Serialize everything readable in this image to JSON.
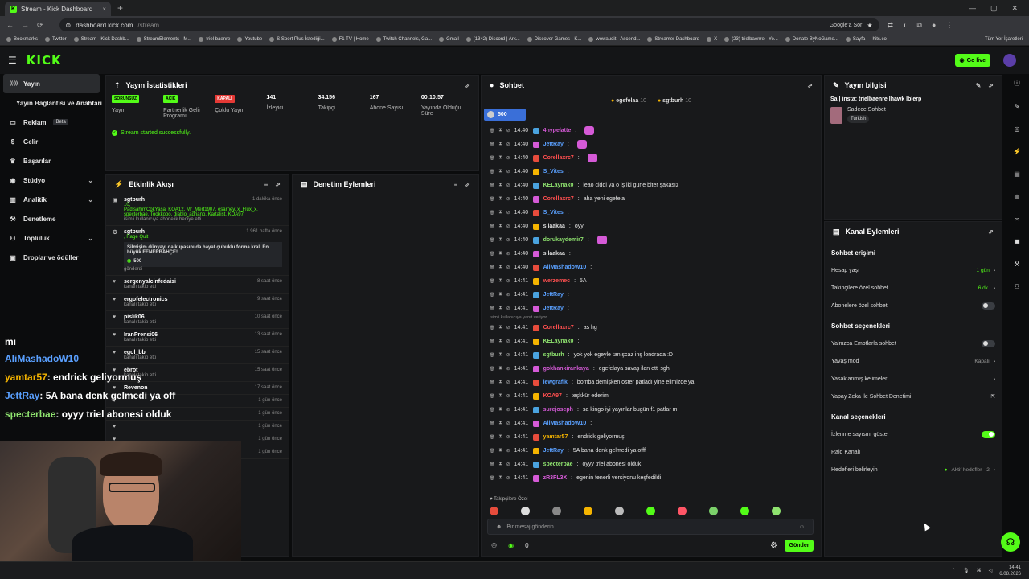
{
  "browser": {
    "tab_title": "Stream - Kick Dashboard",
    "url_host": "dashboard.kick.com",
    "url_path": "/stream",
    "google_sor": "Google'a Sor",
    "bookmarks": [
      "Bookmarks",
      "Twitter",
      "Stream - Kick Dashb...",
      "StreamElements - M...",
      "triel baenre",
      "Youtube",
      "S Sport Plus-İstediği...",
      "F1 TV | Home",
      "Twitch Channels, Ga...",
      "Gmail",
      "(1342) Discord | Ark...",
      "Discover Games - K...",
      "wowaudit - Ascend...",
      "Streamer Dashboard",
      "X",
      "(23) trielbaenre - Yo...",
      "Donate ByNoGame...",
      "Sayfa — hits.co"
    ],
    "bookmarks_right": "Tüm Yer İşaretleri"
  },
  "topbar": {
    "logo": "KICK",
    "go_live": "Go live"
  },
  "sidebar": {
    "items": [
      {
        "label": "Yayın",
        "icon": "broadcast-icon"
      },
      {
        "label": "Yayın Bağlantısı ve Anahtarı",
        "icon": ""
      },
      {
        "label": "Reklam",
        "icon": "ad-icon",
        "badge": "Beta"
      },
      {
        "label": "Gelir",
        "icon": "money-icon"
      },
      {
        "label": "Başarılar",
        "icon": "trophy-icon"
      },
      {
        "label": "Stüdyo",
        "icon": "studio-icon"
      },
      {
        "label": "Analitik",
        "icon": "chart-icon"
      },
      {
        "label": "Denetleme",
        "icon": "hammer-icon"
      },
      {
        "label": "Topluluk",
        "icon": "community-icon"
      },
      {
        "label": "Droplar ve ödüller",
        "icon": "gift-icon"
      }
    ]
  },
  "stats": {
    "title": "Yayın İstatistikleri",
    "items": [
      {
        "badge": "SORUNSUZ",
        "badge_color": "#53fc18",
        "label": "Yayın"
      },
      {
        "badge": "AÇIK",
        "badge_color": "#53fc18",
        "label": "Partnerlik Gelir Programı"
      },
      {
        "badge": "KAPALI",
        "badge_color": "#e53935",
        "label": "Çoklu Yayın"
      },
      {
        "value": "141",
        "label": "İzleyici"
      },
      {
        "value": "34.156",
        "label": "Takipçi"
      },
      {
        "value": "167",
        "label": "Abone Sayısı"
      },
      {
        "value": "00:10:57",
        "label": "Yayında Olduğu Süre"
      }
    ],
    "success": "Stream started successfully."
  },
  "activity": {
    "title": "Etkinlik Akışı",
    "events": [
      {
        "name": "sgtburh",
        "time": "1 dakika önce",
        "count": "10,",
        "list": "PadisahimCokYasa, KOA12, Mr_Mert1907, esarney, x_Flux_x, specterbae, Tookkooo, diablo_adriano, Kartalist, KOA97",
        "sub": "isimli kullanıcıya abonelik hediye etti."
      },
      {
        "name": "sgtburh",
        "time": "1.961 hafta önce",
        "tag": ", Rage Quit",
        "quote": "Silmişim dünyayı da kupasını da hayat çubuklu forma kral. En büyük FENERBAHÇE!",
        "amount": "500",
        "sub": "gönderdi"
      },
      {
        "name": "sergenyalcinfedaisi",
        "time": "8 saat önce",
        "sub": "kanalı takip etti"
      },
      {
        "name": "ergofelectronics",
        "time": "9 saat önce",
        "sub": "kanalı takip etti"
      },
      {
        "name": "pislik06",
        "time": "10 saat önce",
        "sub": "kanalı takip etti"
      },
      {
        "name": "IranPrensi06",
        "time": "13 saat önce",
        "sub": "kanalı takip etti"
      },
      {
        "name": "egol_bb",
        "time": "15 saat önce",
        "sub": "kanalı takip etti"
      },
      {
        "name": "ebrot",
        "time": "15 saat önce",
        "sub": "kanalı takip etti"
      },
      {
        "name": "Revenon",
        "time": "17 saat önce",
        "sub": ""
      },
      {
        "name": "",
        "time": "1 gün önce",
        "sub": ""
      },
      {
        "name": "",
        "time": "1 gün önce",
        "sub": ""
      },
      {
        "name": "",
        "time": "1 gün önce",
        "sub": ""
      },
      {
        "name": "",
        "time": "1 gün önce",
        "sub": ""
      },
      {
        "name": "",
        "time": "1 gün önce",
        "sub": ""
      }
    ]
  },
  "moderation": {
    "title": "Denetim Eylemleri"
  },
  "chat": {
    "title": "Sohbet",
    "pinned": [
      {
        "name": "egefelaa",
        "n": "10"
      },
      {
        "name": "sgtburh",
        "n": "10"
      }
    ],
    "goal": "500",
    "replying_note": "isimli kullanıcıya yanıt veriyor",
    "lines": [
      {
        "t": "14:40",
        "u": "4hypelatte",
        "c": "#d55ad7",
        "m": "",
        "e": true
      },
      {
        "t": "14:40",
        "u": "JettRay",
        "c": "#5aa0ff",
        "m": "",
        "e": true
      },
      {
        "t": "14:40",
        "u": "Corellaxrc7",
        "c": "#ff4f4f",
        "m": "",
        "e": true
      },
      {
        "t": "14:40",
        "u": "S_Vites",
        "c": "#5aa0ff",
        "m": "",
        "e": false
      },
      {
        "t": "14:40",
        "u": "KELaynak0",
        "c": "#8fe36f",
        "m": "leao ciddi ya o iş iki güne biter şakasız",
        "e": false
      },
      {
        "t": "14:40",
        "u": "Corellaxrc7",
        "c": "#ff4f4f",
        "m": "aha yeni egefela",
        "e": false
      },
      {
        "t": "14:40",
        "u": "S_Vites",
        "c": "#5aa0ff",
        "m": "",
        "e": false
      },
      {
        "t": "14:40",
        "u": "silaakaa",
        "c": "#ddd",
        "m": "oyy",
        "e": false
      },
      {
        "t": "14:40",
        "u": "dorukaydemir7",
        "c": "#8fe36f",
        "m": "",
        "e": true
      },
      {
        "t": "14:40",
        "u": "silaakaa",
        "c": "#ddd",
        "m": "",
        "e": false
      },
      {
        "t": "14:40",
        "u": "AliMashadoW10",
        "c": "#5aa0ff",
        "m": "",
        "e": false
      },
      {
        "t": "14:41",
        "u": "werzemec",
        "c": "#ff4f4f",
        "m": "5A",
        "e": false
      },
      {
        "t": "14:41",
        "u": "JettRay",
        "c": "#5aa0ff",
        "m": "",
        "e": false
      },
      {
        "t": "14:41",
        "u": "JettRay",
        "c": "#5aa0ff",
        "m": "",
        "e": false
      },
      {
        "t": "14:41",
        "u": "Corellaxrc7",
        "c": "#ff4f4f",
        "m": "as hg",
        "e": false
      },
      {
        "t": "14:41",
        "u": "KELaynak0",
        "c": "#8fe36f",
        "m": "",
        "e": false
      },
      {
        "t": "14:41",
        "u": "sgtburh",
        "c": "#8fe36f",
        "m": "yok yok egeyle tanışcaz inş londrada :D",
        "e": false
      },
      {
        "t": "14:41",
        "u": "gokhankirankaya",
        "c": "#d55ad7",
        "m": "egefelaya savaş ilan etti sgh",
        "e": false
      },
      {
        "t": "14:41",
        "u": "lewgrafik",
        "c": "#5aa0ff",
        "m": "bomba demişken oster patladı yine elimizde ya",
        "e": false
      },
      {
        "t": "14:41",
        "u": "KOA97",
        "c": "#ff4f4f",
        "m": "teşkkür ederim",
        "e": false
      },
      {
        "t": "14:41",
        "u": "surejoseph",
        "c": "#d55ad7",
        "m": "sa kingo iyi yayınlar bugün f1 patlar mı",
        "e": false
      },
      {
        "t": "14:41",
        "u": "AliMashadoW10",
        "c": "#5aa0ff",
        "m": "",
        "e": false
      },
      {
        "t": "14:41",
        "u": "yamtar57",
        "c": "#f5b400",
        "m": "endrick geliyormuş",
        "e": false
      },
      {
        "t": "14:41",
        "u": "JettRay",
        "c": "#5aa0ff",
        "m": "5A bana denk gelmedi ya offf",
        "e": false
      },
      {
        "t": "14:41",
        "u": "specterbae",
        "c": "#8fe36f",
        "m": "oyyy triel abonesi olduk",
        "e": false
      },
      {
        "t": "14:41",
        "u": "zR3FL3X",
        "c": "#d55ad7",
        "m": "egenin fenerli versiyonu keşfedildi",
        "e": false
      }
    ],
    "followers_only": "Takipçilere Özel",
    "input_placeholder": "Bir mesaj gönderin",
    "points": "0",
    "send": "Gönder"
  },
  "stream_info": {
    "title": "Yayın bilgisi",
    "stream_title": "Sa | insta: trielbaenre Ihawk Iblerp",
    "category": "Sadece Sohbet",
    "language": "Turkish"
  },
  "channel_actions": {
    "title": "Kanal Eylemleri",
    "chat_access": "Sohbet erişimi",
    "account_age": {
      "label": "Hesap yaşı",
      "value": "1 gün"
    },
    "followers_chat": {
      "label": "Takipçilere özel sohbet",
      "value": "6 dk."
    },
    "subs_chat": {
      "label": "Abonelere özel sohbet"
    },
    "chat_options": "Sohbet seçenekleri",
    "emotes_only": {
      "label": "Yalnızca Emotlarla sohbet"
    },
    "slow_mode": {
      "label": "Yavaş mod",
      "value": "Kapalı"
    },
    "banned_words": {
      "label": "Yasaklanmış kelimeler"
    },
    "ai_mod": {
      "label": "Yapay Zeka ile Sohbet Denetimi"
    },
    "channel_options": "Kanal seçenekleri",
    "show_viewers": {
      "label": "İzlenme sayısını göster"
    },
    "raid": {
      "label": "Raid Kanalı"
    },
    "goals": {
      "label": "Hedefleri belirleyin",
      "value": "Aktif hedefler - 2"
    }
  },
  "overlay": [
    {
      "u": "AliMashadoW10",
      "c": "#5aa0ff",
      "m": ""
    },
    {
      "u": "yamtar57",
      "c": "#f5b400",
      "m": ": endrick geliyormuş"
    },
    {
      "u": "JettRay",
      "c": "#5aa0ff",
      "m": ": 5A  bana denk gelmedi ya off"
    },
    {
      "u": "specterbae",
      "c": "#8fe36f",
      "m": ": oyyy triel abonesi olduk"
    }
  ],
  "overlay_mi": "mı",
  "taskbar": {
    "time": "14:41",
    "date": "6.08.2026"
  }
}
